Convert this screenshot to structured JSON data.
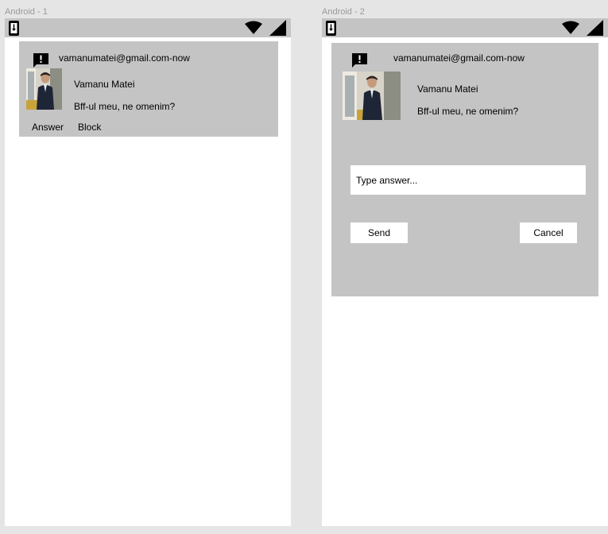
{
  "frames": [
    {
      "label": "Android - 1",
      "notification": {
        "header": "vamanumatei@gmail.com-now",
        "sender_name": "Vamanu Matei",
        "message": "Bff-ul meu, ne omenim?",
        "actions": {
          "answer": "Answer",
          "block": "Block"
        }
      }
    },
    {
      "label": "Android - 2",
      "notification": {
        "header": "vamanumatei@gmail.com-now",
        "sender_name": "Vamanu Matei",
        "message": "Bff-ul meu, ne omenim?",
        "reply_placeholder": "Type answer...",
        "send_label": "Send",
        "cancel_label": "Cancel"
      }
    }
  ],
  "icons": {
    "status_left": "download-icon",
    "wifi": "wifi-icon",
    "signal": "cell-signal-icon",
    "notification_type": "feedback-alert-icon"
  },
  "colors": {
    "background": "#e5e5e5",
    "bar_and_card": "#c4c4c4",
    "screen": "#ffffff"
  }
}
